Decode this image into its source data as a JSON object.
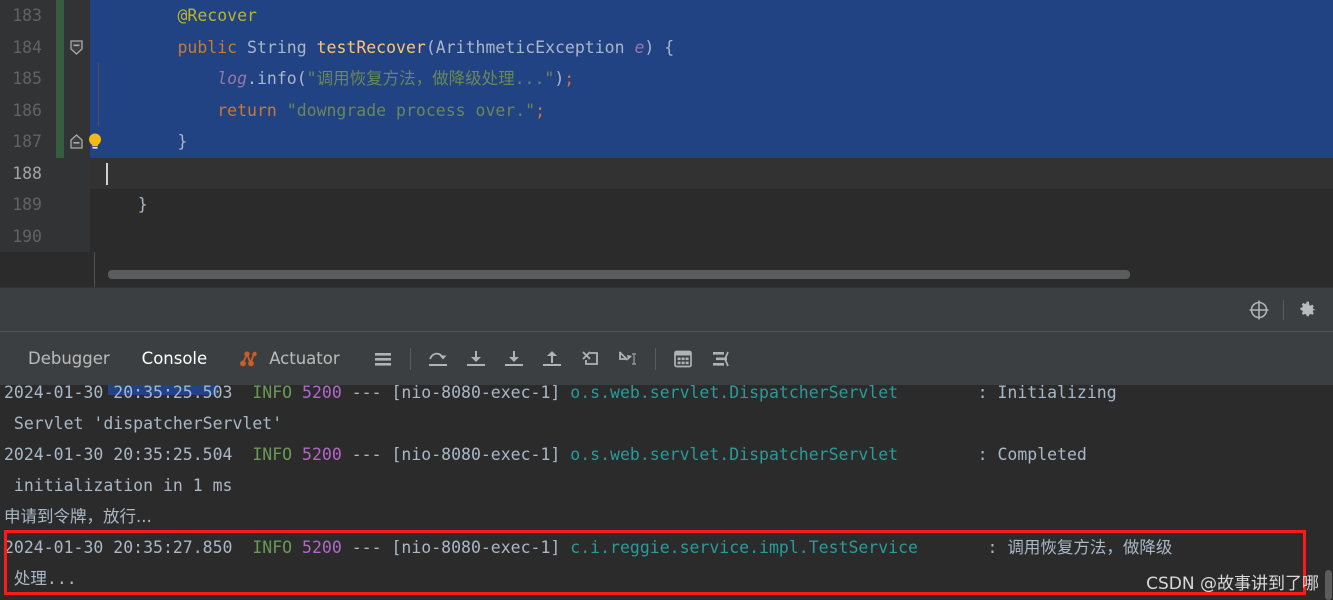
{
  "editor": {
    "lines": [
      {
        "number": "183",
        "vcs_changed": true,
        "selected": true,
        "indent": "        ",
        "text": "@Recover",
        "tokens": [
          {
            "t": "        ",
            "c": "tk-pl"
          },
          {
            "t": "@Recover",
            "c": "tk-anno"
          }
        ]
      },
      {
        "number": "184",
        "vcs_changed": true,
        "selected": true,
        "fold": "collapse",
        "text": "public String testRecover(ArithmeticException e) {",
        "tokens": [
          {
            "t": "        ",
            "c": "tk-pl"
          },
          {
            "t": "public",
            "c": "tk-kw"
          },
          {
            "t": " ",
            "c": "tk-pl"
          },
          {
            "t": "String",
            "c": "tk-type"
          },
          {
            "t": " ",
            "c": "tk-pl"
          },
          {
            "t": "testRecover",
            "c": "tk-mth"
          },
          {
            "t": "(",
            "c": "tk-pl"
          },
          {
            "t": "ArithmeticException",
            "c": "tk-cls"
          },
          {
            "t": " ",
            "c": "tk-pl"
          },
          {
            "t": "e",
            "c": "tk-fld"
          },
          {
            "t": ") {",
            "c": "tk-pl"
          }
        ]
      },
      {
        "number": "185",
        "vcs_changed": true,
        "selected": true,
        "indent_guide": true,
        "text": "log.info(\"调用恢复方法，做降级处理...\");",
        "tokens": [
          {
            "t": "            ",
            "c": "tk-pl"
          },
          {
            "t": "log",
            "c": "tk-fld"
          },
          {
            "t": ".info(",
            "c": "tk-pl"
          },
          {
            "t": "\"调用恢复方法，做降级处理...\"",
            "c": "tk-str"
          },
          {
            "t": ")",
            "c": "tk-pl"
          },
          {
            "t": ";",
            "c": "tk-semi"
          }
        ]
      },
      {
        "number": "186",
        "vcs_changed": true,
        "selected": true,
        "indent_guide": true,
        "text": "return \"downgrade process over.\";",
        "tokens": [
          {
            "t": "            ",
            "c": "tk-pl"
          },
          {
            "t": "return",
            "c": "tk-kw"
          },
          {
            "t": " ",
            "c": "tk-pl"
          },
          {
            "t": "\"downgrade process over.\"",
            "c": "tk-str"
          },
          {
            "t": ";",
            "c": "tk-semi"
          }
        ]
      },
      {
        "number": "187",
        "vcs_changed": true,
        "selected": true,
        "fold": "expand",
        "bulb": true,
        "text": "}",
        "tokens": [
          {
            "t": "        ",
            "c": "tk-pl"
          },
          {
            "t": "}",
            "c": "tk-pl"
          }
        ]
      },
      {
        "number": "188",
        "vcs_changed": false,
        "caret": true,
        "active": true,
        "text": "",
        "tokens": []
      },
      {
        "number": "189",
        "vcs_changed": false,
        "text": "}",
        "tokens": [
          {
            "t": "    ",
            "c": "tk-pl"
          },
          {
            "t": "}",
            "c": "tk-pl"
          }
        ]
      },
      {
        "number": "190",
        "vcs_changed": false,
        "text": "",
        "tokens": []
      }
    ]
  },
  "panel_top": {
    "icons": [
      {
        "name": "target-icon",
        "label": "Settle / Locate"
      },
      {
        "name": "gear-icon",
        "label": "Settings"
      }
    ]
  },
  "panel": {
    "tabs": [
      {
        "label": "Debugger",
        "name": "tab-debugger",
        "active": false,
        "icon": null
      },
      {
        "label": "Console",
        "name": "tab-console",
        "active": true,
        "icon": null
      },
      {
        "label": "Actuator",
        "name": "tab-actuator",
        "active": false,
        "icon": "actuator-icon"
      }
    ],
    "toolbar": [
      {
        "name": "layout-settings-icon",
        "label": "Layout Settings"
      },
      {
        "name": "step-over-icon",
        "label": "Step Over"
      },
      {
        "name": "step-into-icon",
        "label": "Step Into"
      },
      {
        "name": "force-step-into-icon",
        "label": "Force Step Into"
      },
      {
        "name": "step-out-icon",
        "label": "Step Out"
      },
      {
        "name": "drop-frame-icon",
        "label": "Drop Frame"
      },
      {
        "name": "run-to-cursor-icon",
        "label": "Run to Cursor"
      },
      {
        "name": "evaluate-expression-icon",
        "label": "Evaluate Expression"
      },
      {
        "name": "threads-and-variables-icon",
        "label": "Threads & Variables"
      }
    ]
  },
  "console": {
    "lines": [
      {
        "kind": "clipped",
        "parts": [
          {
            "t": "2024-01-30 20:35:25.503",
            "c": "lg-ts"
          },
          {
            "t": "  ",
            "c": "lg-ts"
          },
          {
            "t": "INFO",
            "c": "lg-lvl"
          },
          {
            "t": " ",
            "c": "lg-ts"
          },
          {
            "t": "5200",
            "c": "lg-pid"
          },
          {
            "t": " --- ",
            "c": "lg-dash"
          },
          {
            "t": "[nio-8080-exec-1]",
            "c": "lg-thr"
          },
          {
            "t": " ",
            "c": "lg-ts"
          },
          {
            "t": "o.s.web.servlet.DispatcherServlet",
            "c": "lg-cls"
          },
          {
            "t": "        : Initializing",
            "c": "lg-msg"
          }
        ]
      },
      {
        "kind": "wrap",
        "parts": [
          {
            "t": " Servlet 'dispatcherServlet'",
            "c": "lg-msg"
          }
        ]
      },
      {
        "kind": "normal",
        "parts": [
          {
            "t": "2024-01-30 20:35:25.504",
            "c": "lg-ts"
          },
          {
            "t": "  ",
            "c": "lg-ts"
          },
          {
            "t": "INFO",
            "c": "lg-lvl"
          },
          {
            "t": " ",
            "c": "lg-ts"
          },
          {
            "t": "5200",
            "c": "lg-pid"
          },
          {
            "t": " --- ",
            "c": "lg-dash"
          },
          {
            "t": "[nio-8080-exec-1]",
            "c": "lg-thr"
          },
          {
            "t": " ",
            "c": "lg-ts"
          },
          {
            "t": "o.s.web.servlet.DispatcherServlet",
            "c": "lg-cls"
          },
          {
            "t": "        : Completed",
            "c": "lg-msg"
          }
        ]
      },
      {
        "kind": "wrap",
        "parts": [
          {
            "t": " initialization in 1 ms",
            "c": "lg-msg"
          }
        ]
      },
      {
        "kind": "cn",
        "parts": [
          {
            "t": "申请到令牌，放行...",
            "c": "lg-cn"
          }
        ]
      },
      {
        "kind": "highlighted",
        "parts": [
          {
            "t": "2024-01-30 20:35:27.850",
            "c": "lg-ts"
          },
          {
            "t": "  ",
            "c": "lg-ts"
          },
          {
            "t": "INFO",
            "c": "lg-lvl"
          },
          {
            "t": " ",
            "c": "lg-ts"
          },
          {
            "t": "5200",
            "c": "lg-pid"
          },
          {
            "t": " --- ",
            "c": "lg-dash"
          },
          {
            "t": "[nio-8080-exec-1]",
            "c": "lg-thr"
          },
          {
            "t": " ",
            "c": "lg-ts"
          },
          {
            "t": "c.i.reggie.service.impl.TestService",
            "c": "lg-cls"
          },
          {
            "t": "       : 调用恢复方法，做降级",
            "c": "lg-msg"
          }
        ]
      },
      {
        "kind": "wrap",
        "parts": [
          {
            "t": " 处理...",
            "c": "lg-msg"
          }
        ]
      }
    ],
    "watermark": "CSDN @故事讲到了哪",
    "highlight_color": "#ff1a1a"
  }
}
